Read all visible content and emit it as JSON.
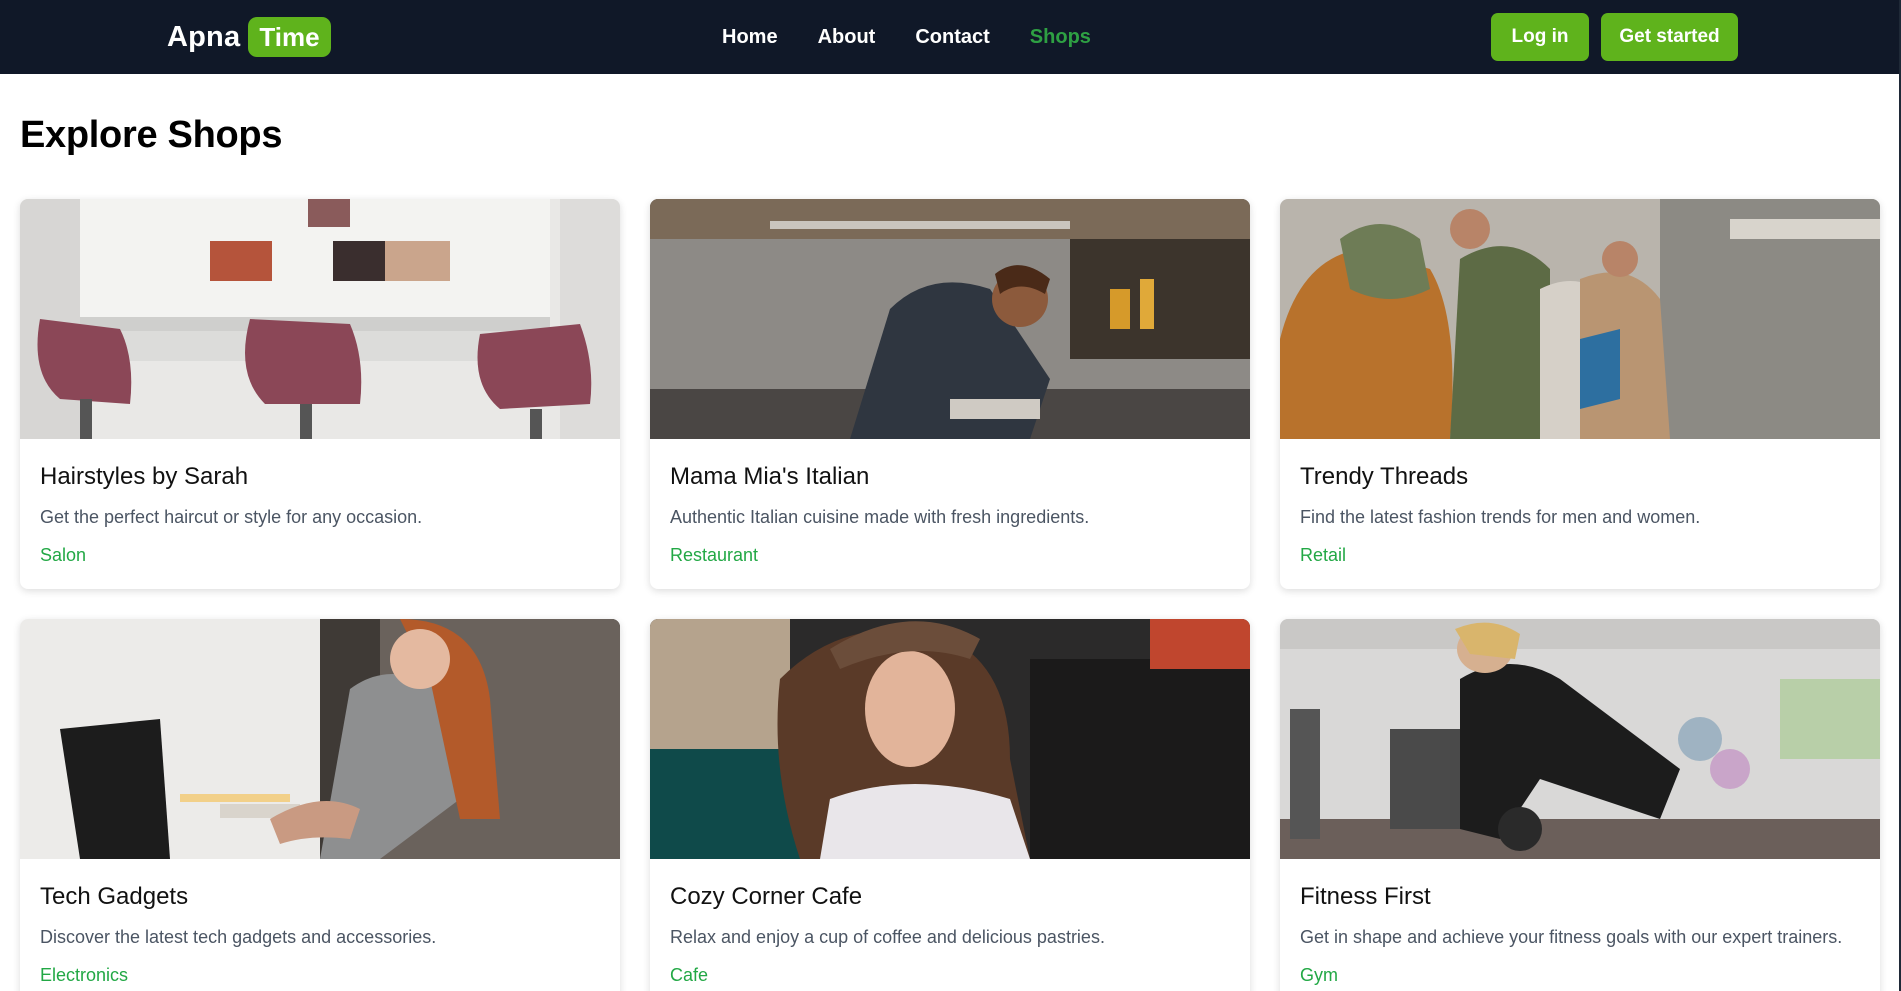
{
  "brand": {
    "name": "Apna",
    "badge": "Time"
  },
  "nav": {
    "links": [
      {
        "label": "Home",
        "active": false
      },
      {
        "label": "About",
        "active": false
      },
      {
        "label": "Contact",
        "active": false
      },
      {
        "label": "Shops",
        "active": true
      }
    ],
    "login_label": "Log in",
    "get_started_label": "Get started"
  },
  "page": {
    "title": "Explore Shops"
  },
  "shops": [
    {
      "title": "Hairstyles by Sarah",
      "description": "Get the perfect haircut or style for any occasion.",
      "category": "Salon",
      "image": "salon-photo"
    },
    {
      "title": "Mama Mia's Italian",
      "description": "Authentic Italian cuisine made with fresh ingredients.",
      "category": "Restaurant",
      "image": "chef-kitchen-photo"
    },
    {
      "title": "Trendy Threads",
      "description": "Find the latest fashion trends for men and women.",
      "category": "Retail",
      "image": "shoppers-photo"
    },
    {
      "title": "Tech Gadgets",
      "description": "Discover the latest tech gadgets and accessories.",
      "category": "Electronics",
      "image": "laptop-user-photo"
    },
    {
      "title": "Cozy Corner Cafe",
      "description": "Relax and enjoy a cup of coffee and delicious pastries.",
      "category": "Cafe",
      "image": "cafe-woman-photo"
    },
    {
      "title": "Fitness First",
      "description": "Get in shape and achieve your fitness goals with our expert trainers.",
      "category": "Gym",
      "image": "gym-workout-photo"
    }
  ],
  "colors": {
    "nav_bg": "#101828",
    "accent": "#5fb31c",
    "active_link": "#2ea043",
    "category": "#22a845"
  }
}
